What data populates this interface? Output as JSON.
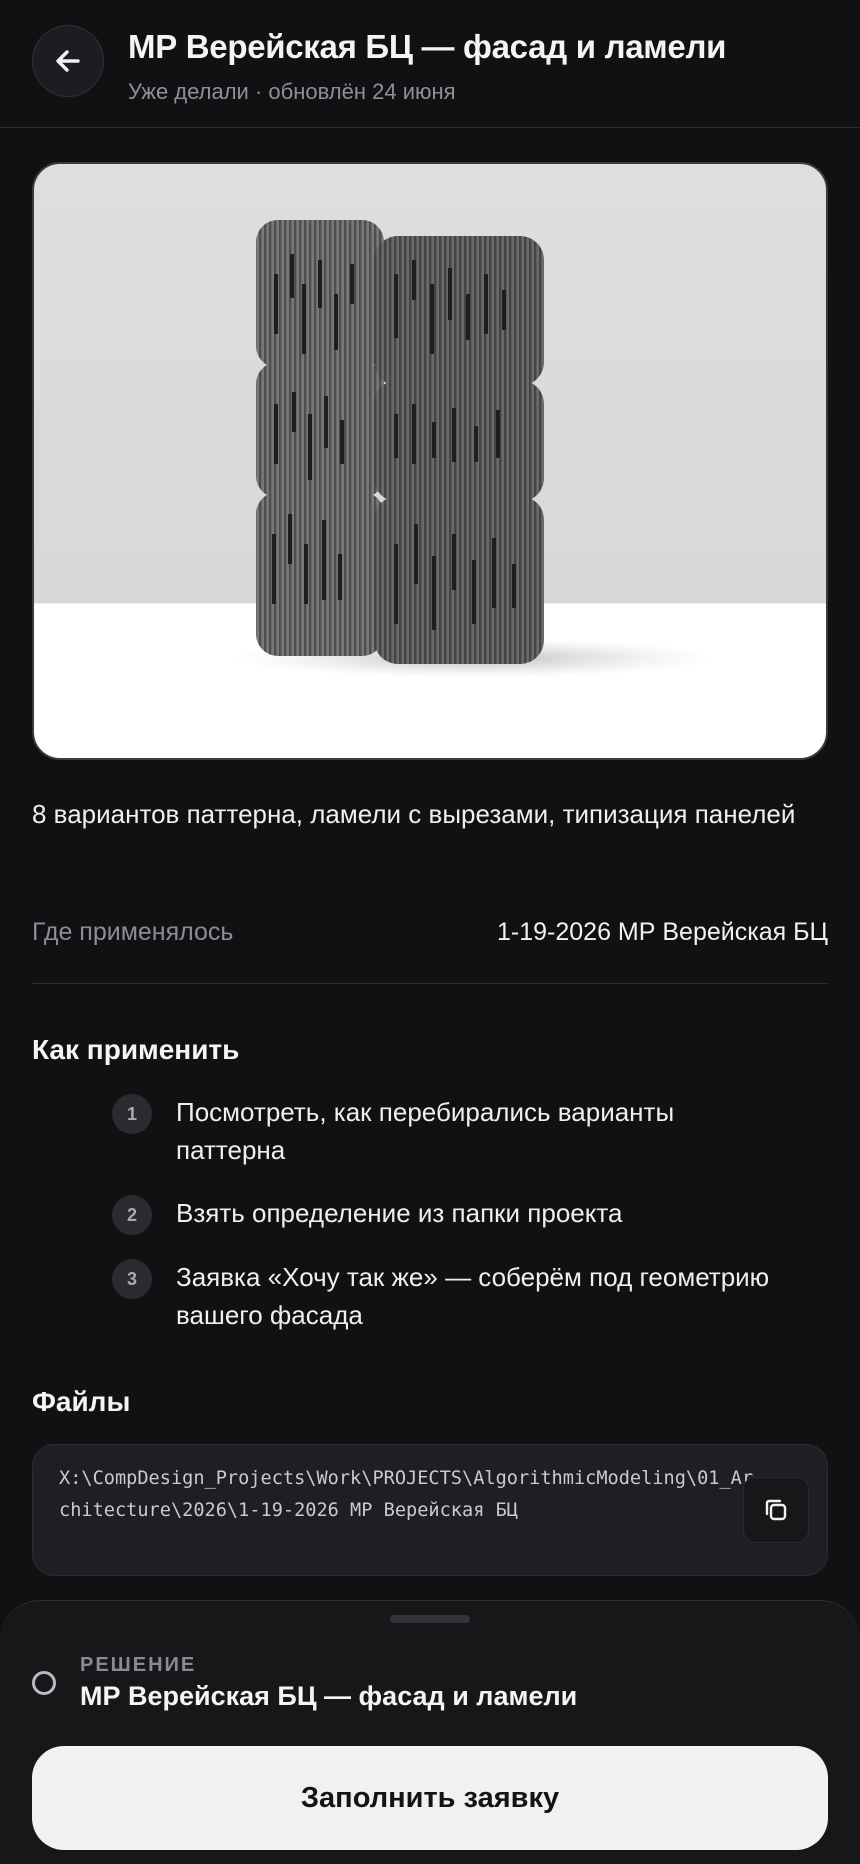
{
  "header": {
    "title": "МР Верейская БЦ — фасад и ламели",
    "subtitle": "Уже делали · обновлён 24 июня",
    "back_icon": "arrow-left-icon"
  },
  "hero": {
    "image": "facade-building-render"
  },
  "description": "8 вариантов паттерна, ламели с вырезами, типизация панелей",
  "applied": {
    "label": "Где применялось",
    "value": "1-19-2026 МР Верейская БЦ"
  },
  "how_to": {
    "title": "Как применить",
    "steps": [
      {
        "num": "1",
        "text": "Посмотреть, как перебирались варианты паттерна"
      },
      {
        "num": "2",
        "text": "Взять определение из папки проекта"
      },
      {
        "num": "3",
        "text": "Заявка «Хочу так же» — соберём под геометрию вашего фасада"
      }
    ]
  },
  "files": {
    "title": "Файлы",
    "path": "X:\\CompDesign_Projects\\Work\\PROJECTS\\AlgorithmicModeling\\01_Architecture\\2026\\1-19-2026 МР Верейская БЦ",
    "copy_icon": "copy-icon"
  },
  "sheet": {
    "kicker": "РЕШЕНИЕ",
    "title": "МР Верейская БЦ — фасад и ламели",
    "cta_label": "Заполнить заявку"
  },
  "colors": {
    "background": "#111113",
    "sheet": "#17171a",
    "cta_bg": "#f1f1f2",
    "muted_text": "#8c8c94"
  }
}
